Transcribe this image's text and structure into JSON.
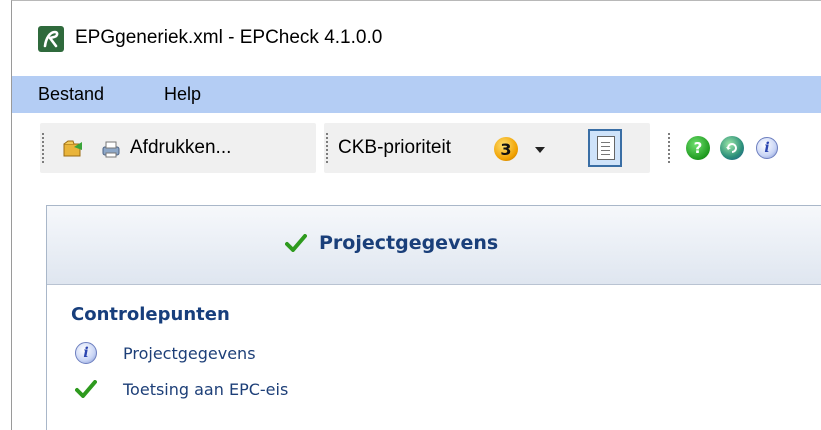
{
  "window": {
    "title": "EPGgeneriek.xml - EPCheck 4.1.0.0"
  },
  "menu": {
    "items": [
      {
        "label": "Bestand"
      },
      {
        "label": "Help"
      }
    ]
  },
  "toolbar": {
    "open_icon": "open-folder-icon",
    "print_icon": "printer-icon",
    "print_label": "Afdrukken...",
    "priority_label": "CKB-prioriteit",
    "priority_value": "3",
    "report_icon": "document-icon",
    "help_icon": "question-icon",
    "refresh_icon": "globe-arrow-icon",
    "info_icon": "info-icon"
  },
  "panel": {
    "title": "Projectgegevens",
    "status_icon": "checkmark-icon",
    "section_heading": "Controlepunten",
    "items": [
      {
        "label": "Projectgegevens",
        "icon": "info-icon"
      },
      {
        "label": "Toetsing aan EPC-eis",
        "icon": "checkmark-icon"
      }
    ]
  },
  "colors": {
    "menubar": "#b4cdf4",
    "heading_text": "#1a3f7a",
    "check_green": "#2e9a1e"
  }
}
